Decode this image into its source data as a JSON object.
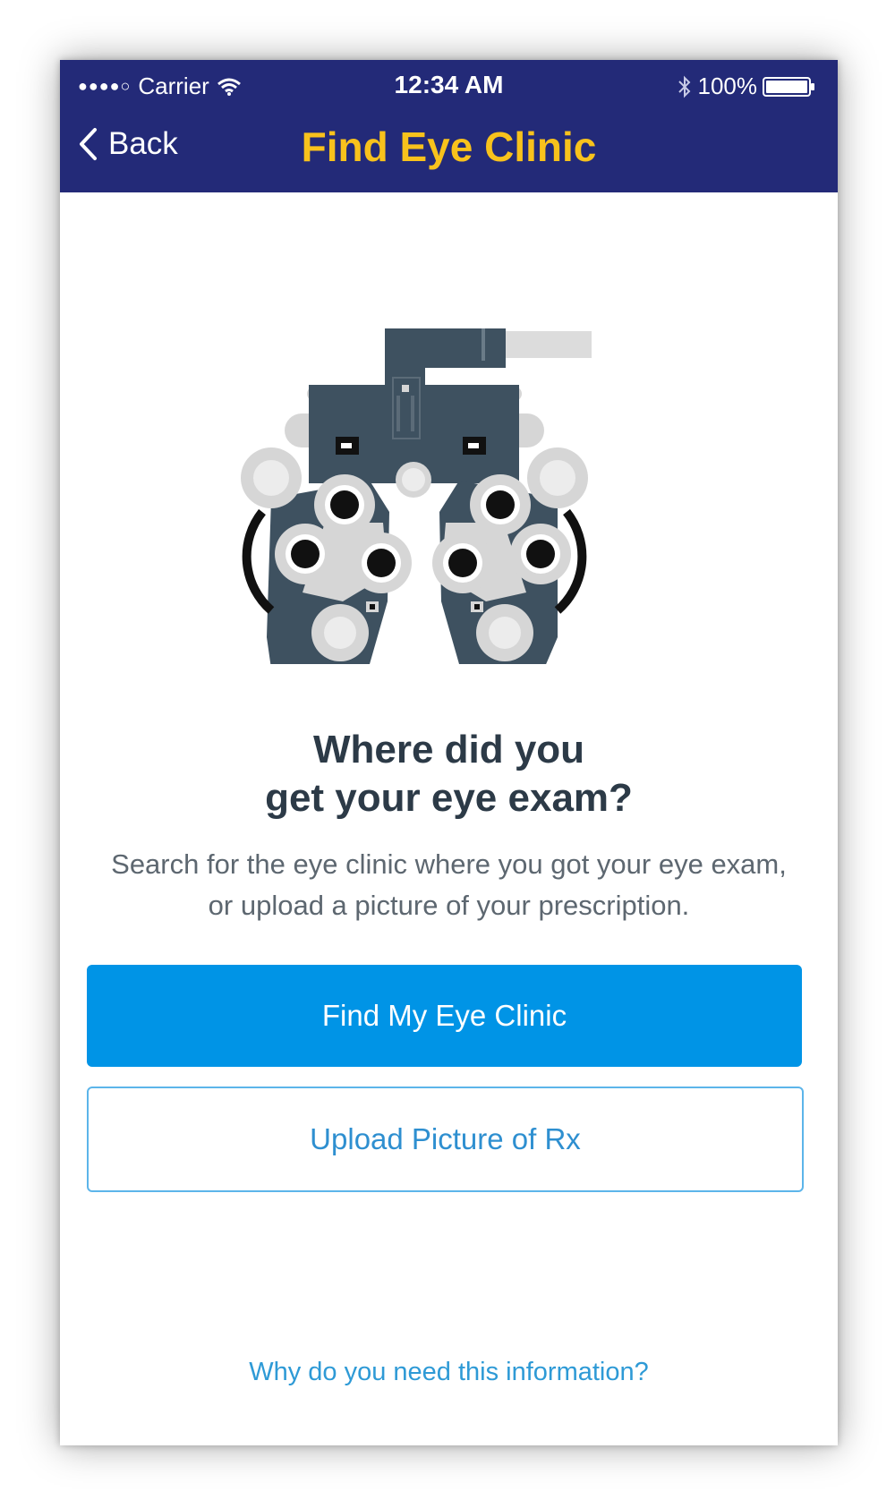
{
  "status_bar": {
    "signal": "●●●●○",
    "carrier": "Carrier",
    "time": "12:34 AM",
    "battery": "100%"
  },
  "nav": {
    "back_label": "Back",
    "title": "Find Eye Clinic"
  },
  "main": {
    "heading_line1": "Where did you",
    "heading_line2": "get your eye exam?",
    "subtext": "Search for the eye clinic where you got your eye exam, or upload a picture of your prescription.",
    "primary_button": "Find My Eye Clinic",
    "secondary_button": "Upload Picture of Rx",
    "help_link": "Why do you need this information?"
  },
  "colors": {
    "header_bg": "#232a78",
    "title": "#f8c21c",
    "primary": "#0094e6",
    "link": "#2e9ad6",
    "illustration_dark": "#3e5160",
    "illustration_light": "#d6d6d6"
  },
  "icons": [
    "wifi-icon",
    "bluetooth-icon",
    "battery-icon",
    "chevron-left-icon",
    "phoropter-illustration"
  ]
}
